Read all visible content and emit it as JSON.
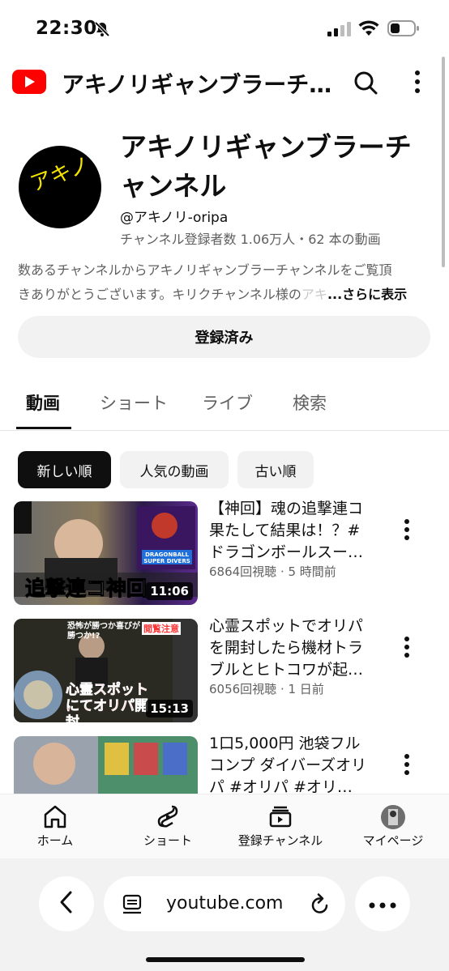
{
  "status_bar": {
    "time": "22:30"
  },
  "header": {
    "title": "アキノリギャンブラーチ…"
  },
  "channel": {
    "name": "アキノリギャンブラーチャンネル",
    "avatar_text": "アキノリ",
    "handle": "@アキノリ-oripa",
    "stats": "チャンネル登録者数 1.06万人・62 本の動画",
    "description_line1": "数あるチャンネルからアキノリギャンブラーチャンネルをご覧頂",
    "description_line2": "きありがとうございます。キリクチャンネル様の",
    "description_fade": "アキ",
    "description_more": "...さらに表示",
    "subscribe_label": "登録済み"
  },
  "tabs": [
    "動画",
    "ショート",
    "ライブ",
    "検索"
  ],
  "chips": [
    "新しい順",
    "人気の動画",
    "古い順"
  ],
  "videos": [
    {
      "title": "【神回】魂の追撃連コ果たして結果は！？#ドラゴンボールスー…",
      "meta": "6864回視聴 · 5 時間前",
      "duration": "11:06",
      "thumb_caption": "追撃連コ神回",
      "thumb_badge": "DRAGONBALL SUPER DIVERS"
    },
    {
      "title": "心霊スポットでオリパを開封したら機材トラブルとヒトコワが起…",
      "meta": "6056回視聴 · 1 日前",
      "duration": "15:13",
      "thumb_caption": "心霊スポットにてオリパ開封",
      "thumb_top": "恐怖が勝つか喜びが勝つか!?",
      "thumb_tag": "閲覧注意"
    },
    {
      "title": "1口5,000円 池袋フルコンプ ダイバーズオリパ #オリパ #オリ…",
      "meta": "",
      "duration": ""
    }
  ],
  "bottom_nav": [
    "ホーム",
    "ショート",
    "登録チャンネル",
    "マイページ"
  ],
  "browser": {
    "url": "youtube.com"
  },
  "colors": {
    "brand_red": "#ff0000",
    "accent_yellow": "#f5e400"
  }
}
